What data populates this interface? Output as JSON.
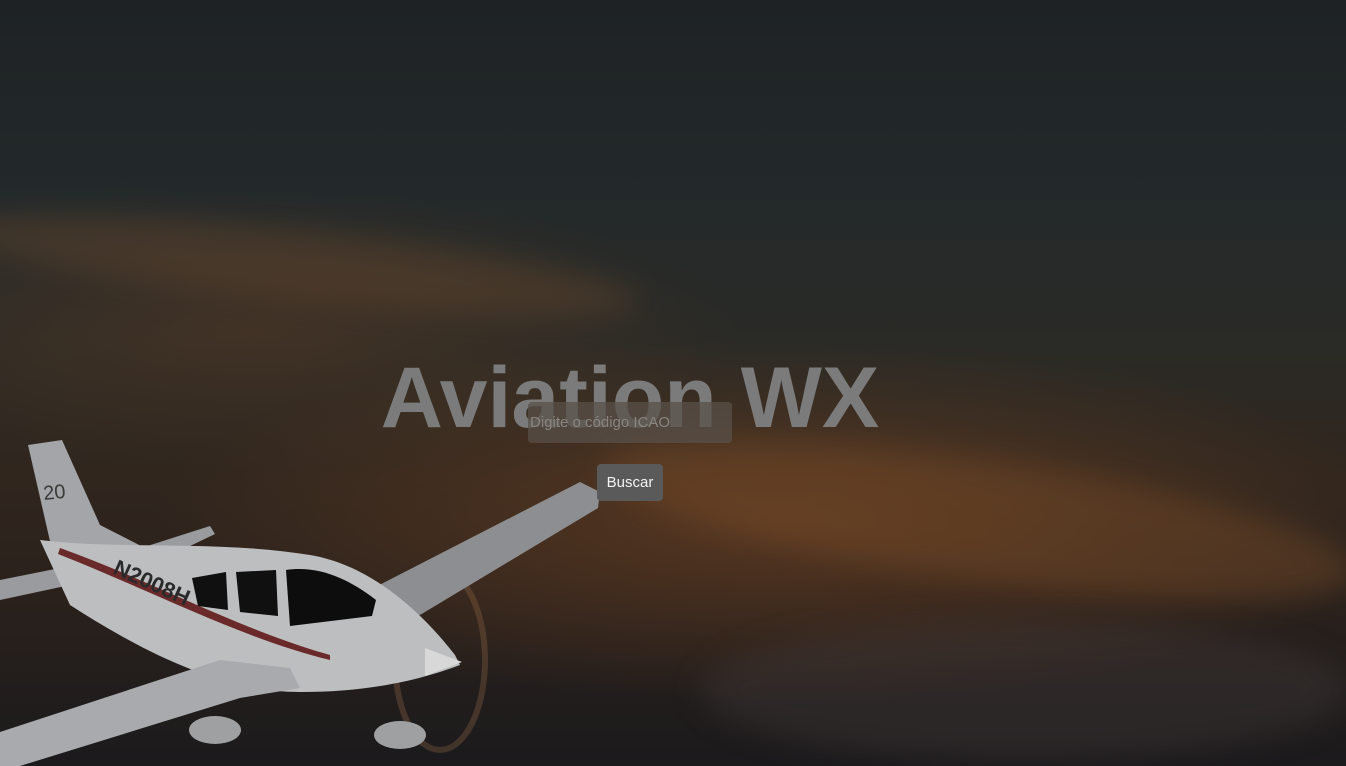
{
  "app": {
    "title": "Aviation WX"
  },
  "search": {
    "placeholder": "Digite o código ICAO",
    "value": "",
    "button_label": "Buscar"
  },
  "background": {
    "aircraft_registration": "N2008H",
    "tail_marking": "20"
  },
  "colors": {
    "title": "#7b7b7b",
    "input_bg": "#58504a",
    "button_bg": "#5a5a5a",
    "button_text": "#f2f2f2"
  }
}
